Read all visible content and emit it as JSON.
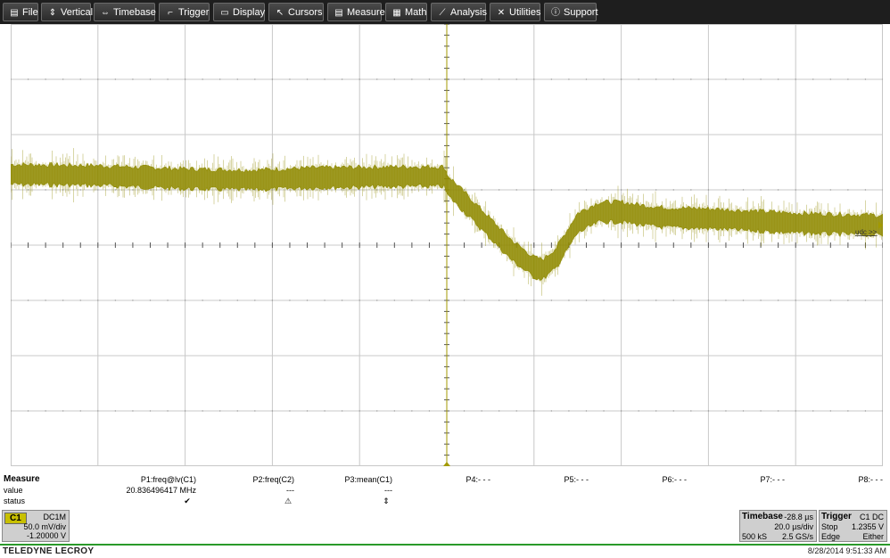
{
  "menu": [
    {
      "label": "File",
      "icon": "file-icon",
      "glyph": "▤"
    },
    {
      "label": "Vertical",
      "icon": "vertical-arrows-icon",
      "glyph": "⇕"
    },
    {
      "label": "Timebase",
      "icon": "horizontal-arrows-icon",
      "glyph": "⇔"
    },
    {
      "label": "Trigger",
      "icon": "trigger-icon",
      "glyph": "⌐"
    },
    {
      "label": "Display",
      "icon": "display-icon",
      "glyph": "▭"
    },
    {
      "label": "Cursors",
      "icon": "cursor-icon",
      "glyph": "↖"
    },
    {
      "label": "Measure",
      "icon": "measure-icon",
      "glyph": "▤"
    },
    {
      "label": "Math",
      "icon": "calculator-icon",
      "glyph": "▦"
    },
    {
      "label": "Analysis",
      "icon": "analysis-chart-icon",
      "glyph": "⟋"
    },
    {
      "label": "Utilities",
      "icon": "tools-icon",
      "glyph": "✕"
    },
    {
      "label": "Support",
      "icon": "info-icon",
      "glyph": "ⓘ"
    }
  ],
  "scope": {
    "trace_color": "#8f8a00",
    "trigger_color": "#a39a00",
    "grid_color": "#c8c8c8",
    "marker_label": "udc >>",
    "ground_marker": "1"
  },
  "chart_data": {
    "type": "line",
    "title": "",
    "xlabel": "",
    "ylabel": "",
    "grid": true,
    "divisions": {
      "x": 10,
      "y": 8
    },
    "x_units": "µs",
    "y_units": "mV",
    "xlim": [
      -100,
      100
    ],
    "ylim": [
      -200,
      200
    ],
    "series": [
      {
        "name": "C1",
        "x": [
          -100,
          -80,
          -60,
          -45,
          -30,
          -10,
          -0.5,
          0,
          5,
          10,
          15,
          20,
          22,
          25,
          30,
          35,
          40,
          45,
          50,
          60,
          70,
          80,
          100
        ],
        "y": [
          64,
          63,
          60,
          59,
          61,
          62,
          62,
          55,
          35,
          15,
          -5,
          -20,
          -22,
          -12,
          20,
          30,
          30,
          27,
          25,
          24,
          22,
          20,
          18
        ],
        "band_mV": 9
      }
    ]
  },
  "measure": {
    "header": "Measure",
    "row_value": "value",
    "row_status": "status",
    "params": [
      {
        "label": "P1:freq@lv(C1)",
        "value": "20.836496417 MHz",
        "status": "✔",
        "status_icon": "check-icon"
      },
      {
        "label": "P2:freq(C2)",
        "value": "---",
        "status": "⚠",
        "status_icon": "warning-icon"
      },
      {
        "label": "P3:mean(C1)",
        "value": "---",
        "status": "⇕",
        "status_icon": "updown-icon"
      },
      {
        "label": "P4:- - -",
        "value": "",
        "status": ""
      },
      {
        "label": "P5:- - -",
        "value": "",
        "status": ""
      },
      {
        "label": "P6:- - -",
        "value": "",
        "status": ""
      },
      {
        "label": "P7:- - -",
        "value": "",
        "status": ""
      },
      {
        "label": "P8:- - -",
        "value": "",
        "status": ""
      }
    ]
  },
  "channel": {
    "tag": "C1",
    "coupling": "DC1M",
    "scale": "50.0 mV/div",
    "offset": "-1.20000 V",
    "tag_color": "#c8c000"
  },
  "timebase": {
    "title": "Timebase",
    "delay": "-28.8 µs",
    "per_div": "20.0 µs/div",
    "samples": "500 kS",
    "rate": "2.5 GS/s"
  },
  "trigger": {
    "title": "Trigger",
    "source": "C1 DC",
    "mode": "Stop",
    "level": "1.2355 V",
    "type": "Edge",
    "slope": "Either"
  },
  "footer": {
    "brand": "TELEDYNE LECROY",
    "datetime": "8/28/2014 9:51:33 AM"
  }
}
